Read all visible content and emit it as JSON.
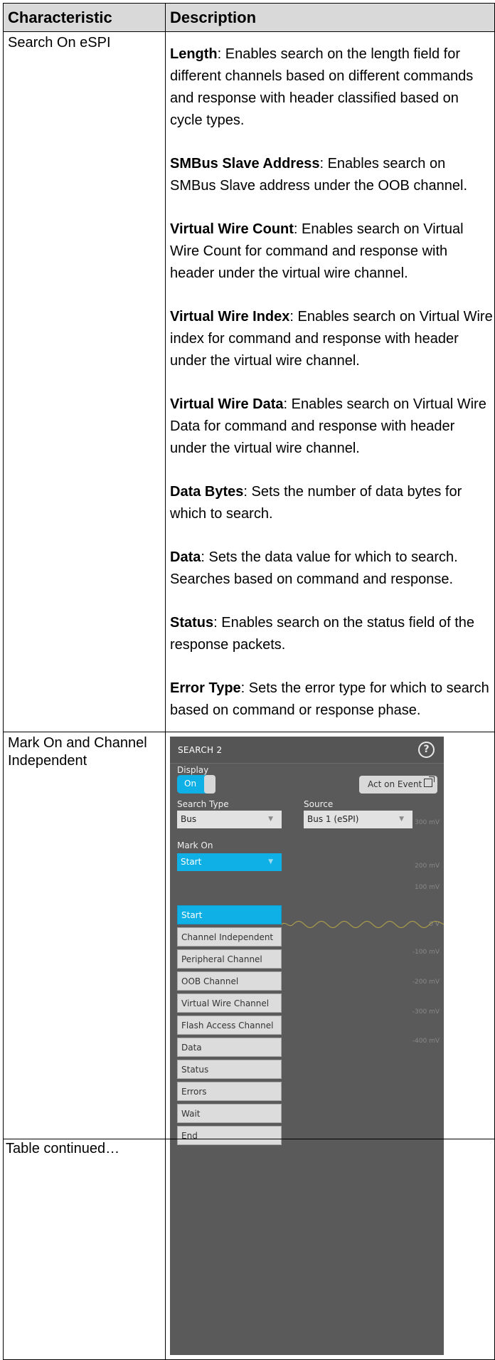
{
  "table": {
    "headers": [
      "Characteristic",
      "Description"
    ],
    "rows": [
      {
        "characteristic": "Search On eSPI",
        "items": [
          {
            "term": "Length",
            "text": ": Enables search on the length field for different channels based on different commands and response with header classified based on cycle types."
          },
          {
            "term": "SMBus Slave Address",
            "text": ": Enables search on SMBus Slave address under the OOB channel."
          },
          {
            "term": "Virtual Wire Count",
            "text": ": Enables search on Virtual Wire Count for command and response with header under the virtual wire channel."
          },
          {
            "term": "Virtual Wire Index",
            "text": ": Enables search on Virtual Wire index for command and response with header under the virtual wire channel."
          },
          {
            "term": "Virtual Wire Data",
            "text": ": Enables search on Virtual Wire Data for command and response with header under the virtual wire channel."
          },
          {
            "term": "Data Bytes",
            "text": ": Sets the number of data bytes for which to search."
          },
          {
            "term": "Data",
            "text": ": Sets the data value for which to search. Searches based on command and response."
          },
          {
            "term": "Status",
            "text": ": Enables search on the status field of the response packets."
          },
          {
            "term": "Error Type",
            "text": ": Sets the error type for which to search based on command or response phase."
          }
        ]
      },
      {
        "characteristic": "Mark On and Channel Independent"
      }
    ],
    "footer": "Table continued…"
  },
  "panel": {
    "title": "SEARCH 2",
    "help_icon": "?",
    "display_label": "Display",
    "toggle_label": "On",
    "toggle_on": true,
    "act_on_event": "Act on Event",
    "search_type_label": "Search Type",
    "search_type_value": "Bus",
    "source_label": "Source",
    "source_value": "Bus 1 (eSPI)",
    "mark_on_label": "Mark On",
    "mark_on_value": "Start",
    "menu_items": [
      "Start",
      "Channel Independent",
      "Peripheral Channel",
      "OOB Channel",
      "Virtual Wire Channel",
      "Flash Access Channel",
      "Data",
      "Status",
      "Errors",
      "Wait",
      "End"
    ],
    "menu_selected": "Start",
    "axis_ticks": [
      "300 mV",
      "200 mV",
      "100 mV",
      "0 V",
      "-100 mV",
      "-200 mV",
      "-300 mV",
      "-400 mV"
    ],
    "accent": "#0fb0e6"
  }
}
